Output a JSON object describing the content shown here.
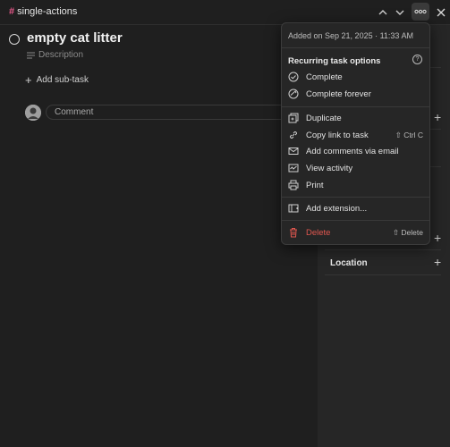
{
  "topbar": {
    "project_name": "single-actions",
    "project_hash": "#"
  },
  "task": {
    "title": "empty cat litter",
    "description_placeholder": "Description",
    "add_subtask_label": "Add sub-task",
    "comment_placeholder": "Comment"
  },
  "sidebar": {
    "location_label": "Location"
  },
  "menu": {
    "added_text": "Added on Sep 21, 2025 · 11:33 AM",
    "recurring_heading": "Recurring task options",
    "help_icon": "?",
    "items": [
      {
        "label": "Complete",
        "icon": "check-circle-icon"
      },
      {
        "label": "Complete forever",
        "icon": "complete-forever-icon"
      },
      {
        "label": "Duplicate",
        "icon": "duplicate-icon"
      },
      {
        "label": "Copy link to task",
        "icon": "link-icon",
        "shortcut": "⇧ Ctrl C"
      },
      {
        "label": "Add comments via email",
        "icon": "mail-icon"
      },
      {
        "label": "View activity",
        "icon": "activity-icon"
      },
      {
        "label": "Print",
        "icon": "print-icon"
      },
      {
        "label": "Add extension...",
        "icon": "extension-icon"
      },
      {
        "label": "Delete",
        "icon": "trash-icon",
        "shortcut": "⇧ Delete"
      }
    ]
  },
  "colors": {
    "background": "#1f1f1f",
    "panel": "#262626",
    "project_hash": "#e8598b",
    "danger": "#e0574f"
  }
}
